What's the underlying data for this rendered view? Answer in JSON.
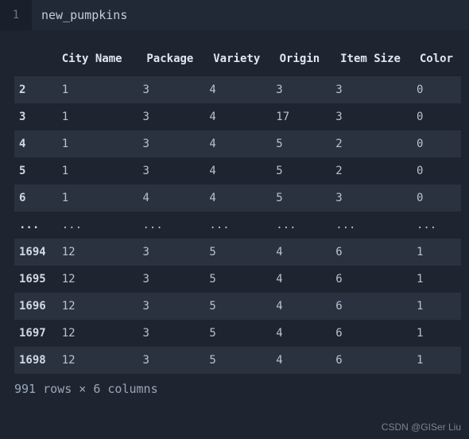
{
  "code": {
    "line_number": "1",
    "text": "new_pumpkins"
  },
  "table": {
    "columns": [
      "",
      "City Name",
      "Package",
      "Variety",
      "Origin",
      "Item Size",
      "Color"
    ],
    "rows": [
      {
        "idx": "2",
        "city": "1",
        "package": "3",
        "variety": "4",
        "origin": "3",
        "size": "3",
        "color": "0"
      },
      {
        "idx": "3",
        "city": "1",
        "package": "3",
        "variety": "4",
        "origin": "17",
        "size": "3",
        "color": "0"
      },
      {
        "idx": "4",
        "city": "1",
        "package": "3",
        "variety": "4",
        "origin": "5",
        "size": "2",
        "color": "0"
      },
      {
        "idx": "5",
        "city": "1",
        "package": "3",
        "variety": "4",
        "origin": "5",
        "size": "2",
        "color": "0"
      },
      {
        "idx": "6",
        "city": "1",
        "package": "4",
        "variety": "4",
        "origin": "5",
        "size": "3",
        "color": "0"
      },
      {
        "idx": "...",
        "city": "...",
        "package": "...",
        "variety": "...",
        "origin": "...",
        "size": "...",
        "color": "..."
      },
      {
        "idx": "1694",
        "city": "12",
        "package": "3",
        "variety": "5",
        "origin": "4",
        "size": "6",
        "color": "1"
      },
      {
        "idx": "1695",
        "city": "12",
        "package": "3",
        "variety": "5",
        "origin": "4",
        "size": "6",
        "color": "1"
      },
      {
        "idx": "1696",
        "city": "12",
        "package": "3",
        "variety": "5",
        "origin": "4",
        "size": "6",
        "color": "1"
      },
      {
        "idx": "1697",
        "city": "12",
        "package": "3",
        "variety": "5",
        "origin": "4",
        "size": "6",
        "color": "1"
      },
      {
        "idx": "1698",
        "city": "12",
        "package": "3",
        "variety": "5",
        "origin": "4",
        "size": "6",
        "color": "1"
      }
    ]
  },
  "summary": "991 rows × 6 columns",
  "watermark": "CSDN @GISer Liu"
}
